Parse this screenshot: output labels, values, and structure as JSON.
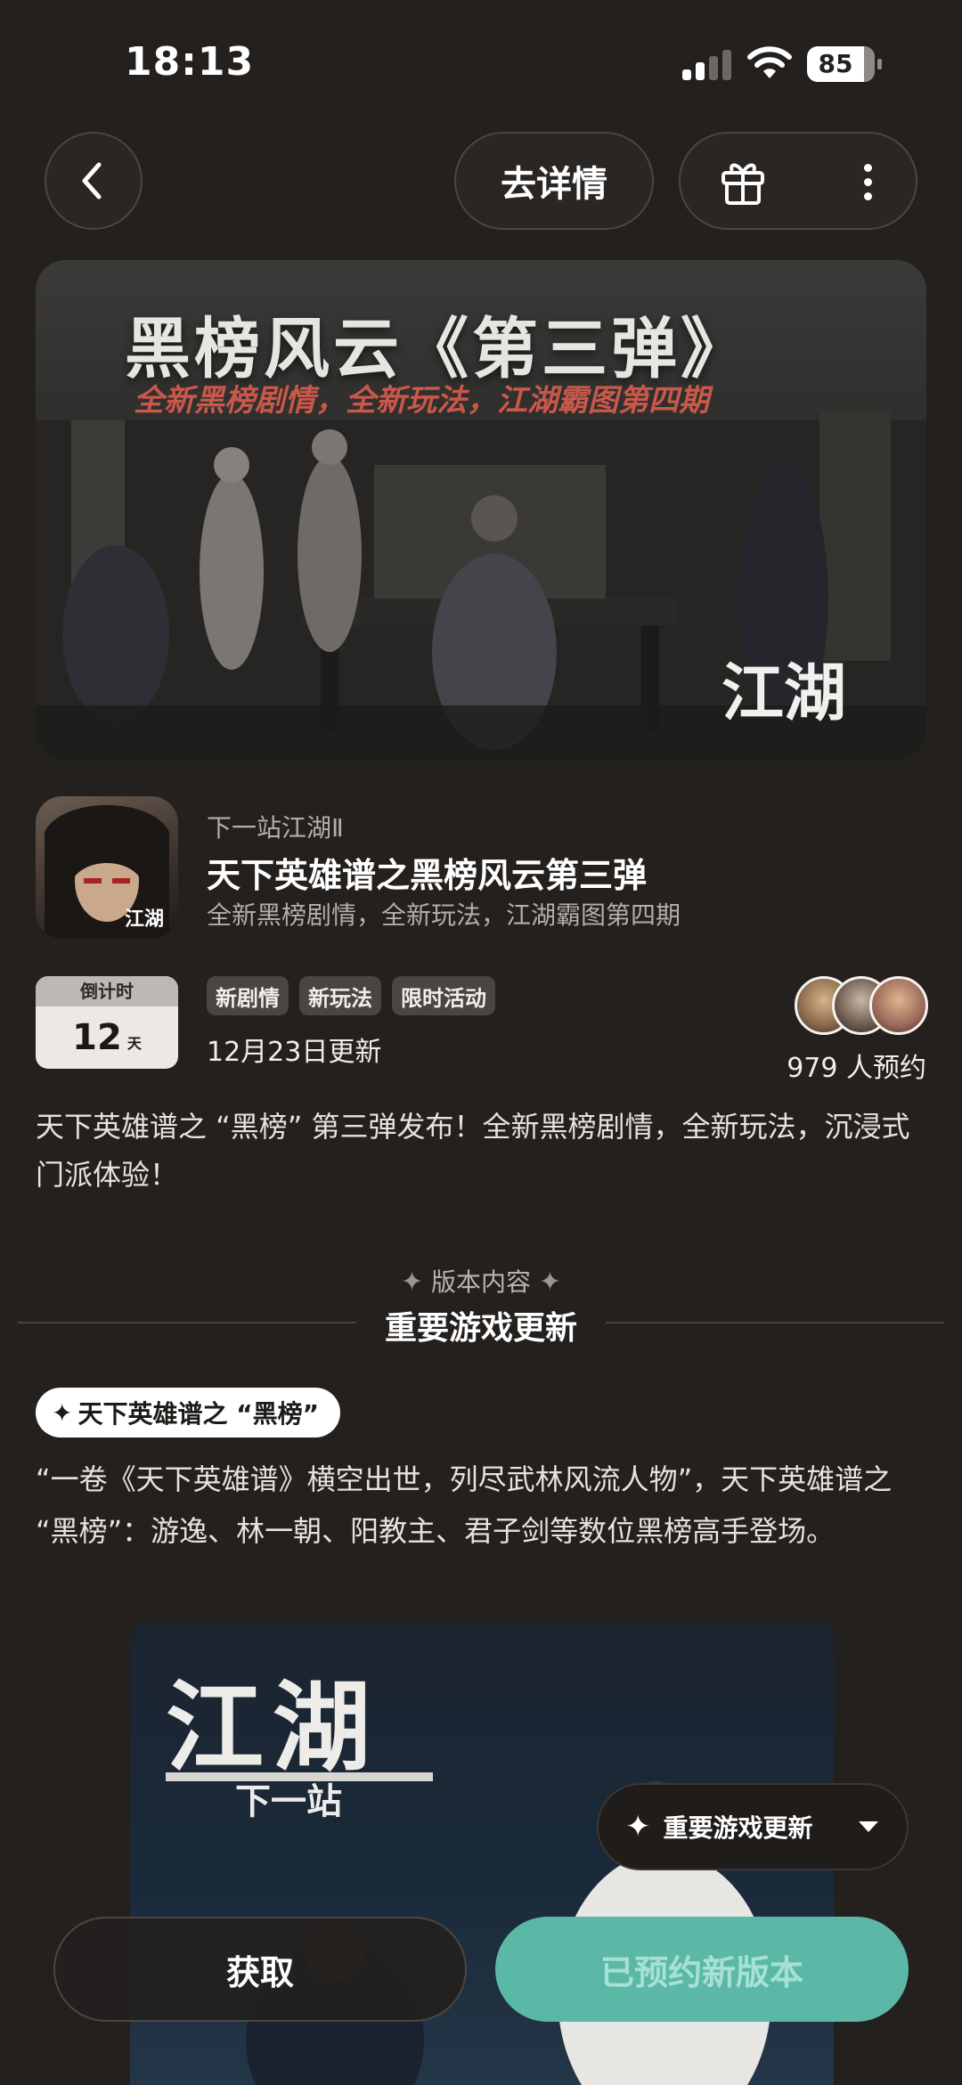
{
  "status_bar": {
    "time": "18:13",
    "battery": "85"
  },
  "nav": {
    "detail_label": "去详情"
  },
  "banner": {
    "title": "黑榜风云《第三弹》",
    "subtitle": "全新黑榜剧情，全新玩法，江湖霸图第四期",
    "logo_text": "江湖"
  },
  "app": {
    "developer": "下一站江湖Ⅱ",
    "title": "天下英雄谱之黑榜风云第三弹",
    "subtitle": "全新黑榜剧情，全新玩法，江湖霸图第四期"
  },
  "countdown": {
    "label": "倒计时",
    "value": "12",
    "unit": "天"
  },
  "tags": [
    "新剧情",
    "新玩法",
    "限时活动"
  ],
  "update_date": "12月23日更新",
  "reservations": "979 人预约",
  "description": "天下英雄谱之 “黑榜” 第三弹发布！全新黑榜剧情，全新玩法，沉浸式门派体验！",
  "section": {
    "label": "版本内容",
    "title": "重要游戏更新"
  },
  "feature_tag": "天下英雄谱之 “黑榜”",
  "feature_text": "“一卷《天下英雄谱》横空出世，列尽武林风流人物”，天下英雄谱之 “黑榜”：游逸、林一朝、阳教主、君子剑等数位黑榜高手登场。",
  "poster": {
    "logo": "江湖",
    "logo_sub": "下一站"
  },
  "jump": {
    "label": "重要游戏更新"
  },
  "bottom": {
    "get_label": "获取",
    "reserved_label": "已预约新版本"
  },
  "colors": {
    "background": "#24201d",
    "accent": "#5cb8a6"
  }
}
